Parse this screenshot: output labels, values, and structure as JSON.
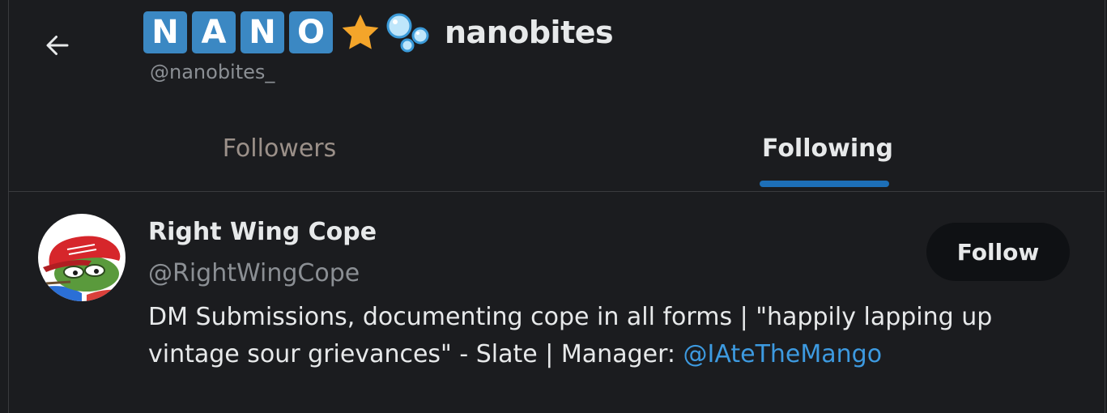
{
  "header": {
    "title_letters": [
      "N",
      "A",
      "N",
      "O"
    ],
    "emoji_star": "star-emoji",
    "emoji_bubbles": "bubbles-emoji",
    "display_name": "nanobites",
    "handle": "@nanobites_"
  },
  "tabs": [
    {
      "label": "Followers",
      "active": false
    },
    {
      "label": "Following",
      "active": true
    }
  ],
  "accent_color": "#1d6fb8",
  "link_color": "#3d9ae0",
  "users": [
    {
      "name": "Right Wing Cope",
      "handle": "@RightWingCope",
      "follow_label": "Follow",
      "bio_text": "DM Submissions, documenting cope in all forms | \"happily lapping up vintage sour grievances\" - Slate | Manager: ",
      "bio_mention": "@IAteTheMango",
      "avatar_icon": "pepe-maga-hat-avatar"
    }
  ]
}
